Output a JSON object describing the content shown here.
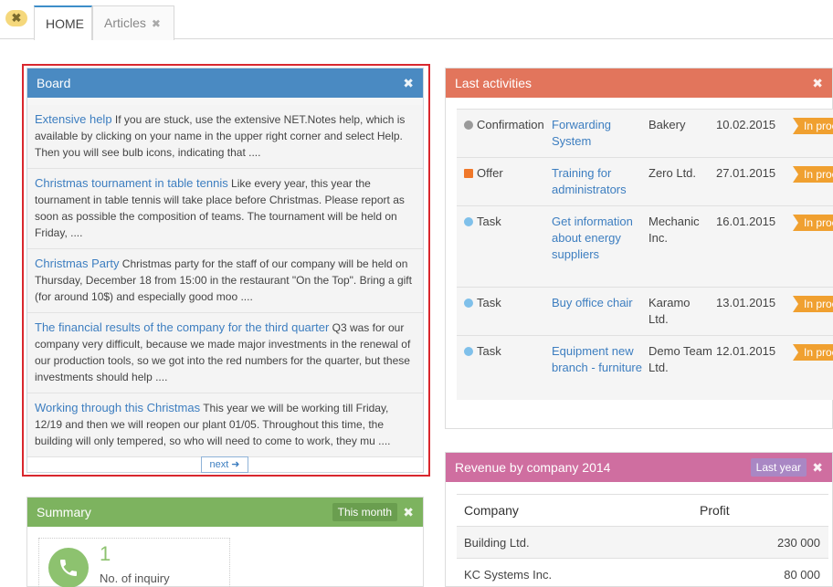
{
  "tabs": {
    "close_glyph": "✖",
    "home": "HOME",
    "articles": "Articles",
    "articles_close": "✖"
  },
  "board": {
    "title": "Board",
    "close": "✖",
    "next": "next ➜",
    "items": [
      {
        "title": "Extensive help",
        "text": " If you are stuck, use the extensive NET.Notes help, which is available by clicking on your name in the upper right corner and select Help. Then you will see bulb icons, indicating that ...."
      },
      {
        "title": "Christmas tournament in table tennis",
        "text": " Like every year, this year the tournament in table tennis will take place before Christmas. Please report as soon as possible the composition of teams. The tournament will be held on Friday, ...."
      },
      {
        "title": "Christmas Party",
        "text": " Christmas party for the staff of our company will be held on Thursday, December 18 from 15:00 in the restaurant \"On the Top\". Bring a gift (for around 10$)  and especially good moo ...."
      },
      {
        "title": "The financial results of the company for the third quarter",
        "text": " Q3 was for our company very difficult, because we made major investments in the renewal of our production tools, so we got into the red numbers for the quarter, but these investments should help ...."
      },
      {
        "title": "Working through this Christmas",
        "text": " This year we will be working till Friday, 12/19 and then we will reopen our plant 01/05. Throughout this time, the building will only tempered, so who will need to come to work, they mu ...."
      }
    ]
  },
  "activities": {
    "title": "Last activities",
    "close": "✖",
    "rows": [
      {
        "type": "Confirmation",
        "dot_color": "#9a9a9a",
        "dot_shape": "circle",
        "subject": "Forwarding System",
        "company": "Bakery",
        "date": "10.02.2015",
        "status": "In process"
      },
      {
        "type": "Offer",
        "dot_color": "#f0782a",
        "dot_shape": "square",
        "subject": "Training for administrators",
        "company": "Zero Ltd.",
        "date": "27.01.2015",
        "status": "In process"
      },
      {
        "type": "Task",
        "dot_color": "#7fc0ea",
        "dot_shape": "circle",
        "subject": "Get information about energy suppliers",
        "company": "Mechanic Inc.",
        "date": "16.01.2015",
        "status": "In process"
      },
      {
        "type": "Task",
        "dot_color": "#7fc0ea",
        "dot_shape": "circle",
        "subject": "Buy office chair",
        "company": "Karamo Ltd.",
        "date": "13.01.2015",
        "status": "In process"
      },
      {
        "type": "Task",
        "dot_color": "#7fc0ea",
        "dot_shape": "circle",
        "subject": "Equipment new branch - furniture",
        "company": "Demo Team Ltd.",
        "date": "12.01.2015",
        "status": "In process"
      }
    ]
  },
  "revenue": {
    "title": "Revenue by company 2014",
    "badge": "Last year",
    "close": "✖",
    "col_company": "Company",
    "col_profit": "Profit",
    "rows": [
      {
        "company": "Building Ltd.",
        "profit": "230 000"
      },
      {
        "company": "KC Systems Inc.",
        "profit": "80 000"
      }
    ]
  },
  "summary": {
    "title": "Summary",
    "badge": "This month",
    "close": "✖",
    "icon": "phone-icon",
    "count": "1",
    "label": "No. of inquiry"
  },
  "colors": {
    "board_head": "#4a8ac2",
    "activities_head": "#e2755c",
    "revenue_head": "#cf6ea0",
    "summary_head": "#7db35f",
    "status": "#f0a030",
    "link": "#3d7ec0"
  }
}
